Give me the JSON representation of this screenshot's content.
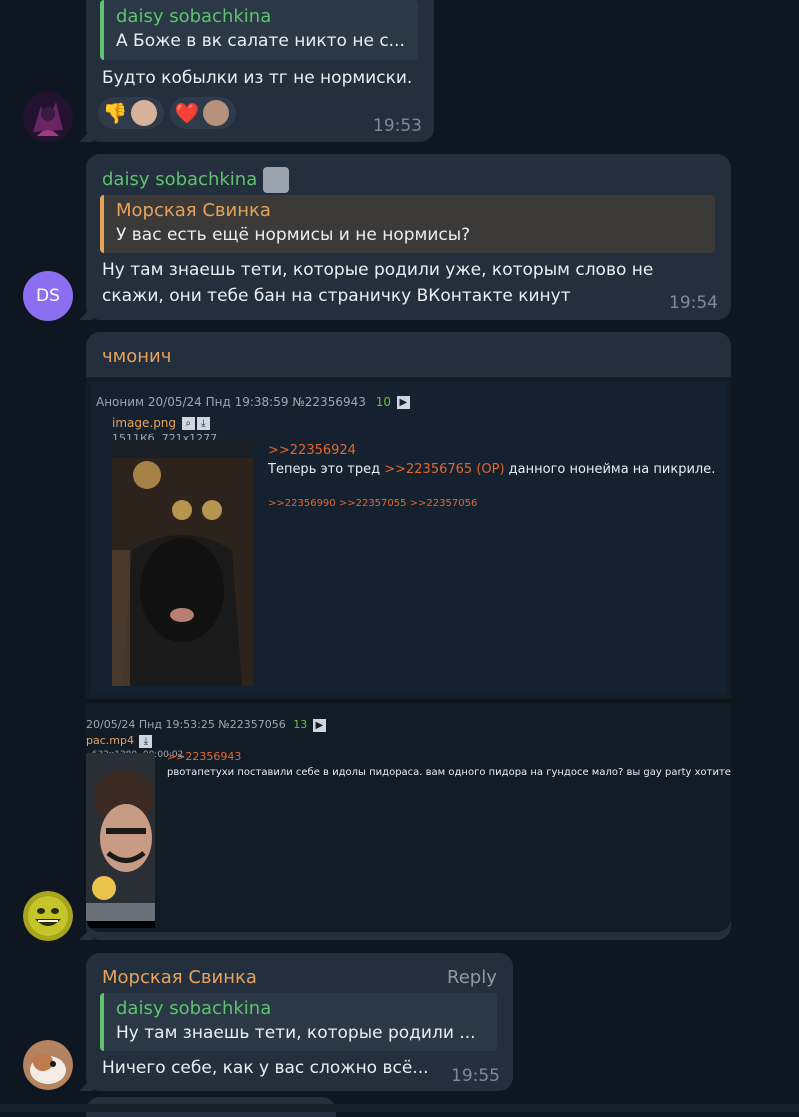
{
  "messages": [
    {
      "quote_name": "daisy sobachkina",
      "quote_text": "А Боже в вк салате никто не с...",
      "text": "Будто кобылки из тг не нормиски.",
      "time": "19:53",
      "reactions": [
        "👎",
        "❤️"
      ]
    },
    {
      "sender": "daisy sobachkina",
      "avatar_initials": "DS",
      "quote_name": "Морская Свинка",
      "quote_text": "У вас есть ещё нормисы и не нормисы?",
      "text_line1": "Ну там знаешь тети, которые родили уже, которым слово не",
      "text_line2": "скажи, они тебе бан на страничку ВКонтакте кинут",
      "time": "19:54"
    },
    {
      "sender": "чмонич",
      "post1": {
        "meta": "Аноним  20/05/24 Пнд 19:38:59  №22356943",
        "replies_count": "10",
        "filename": "image.png",
        "fileinfo": "1511Кб, 721x1277",
        "reply_link": ">>22356924",
        "body_prefix": "Теперь это тред ",
        "body_link": ">>22356765 (OP)",
        "body_suffix": " данного нонейма на пикриле.",
        "backlinks": ">>22356990 >>22357055 >>22357056"
      },
      "post2": {
        "meta": "20/05/24 Пнд 19:53:25 №22357056",
        "replies_count": "13",
        "filename": "рас.mp4",
        "fileinfo": ", 632x1280, 00:00:02",
        "reply_link": ">>22356943",
        "body": "рвотапетухи поставили себе в идолы пидораса. вам одного пидора на гундосе мало? вы gay party хотите устро"
      }
    },
    {
      "sender": "Морская Свинка",
      "reply_label": "Reply",
      "quote_name": "daisy sobachkina",
      "quote_text": "Ну там знаешь тети, которые родили ...",
      "text": "Ничего себе, как у вас сложно всё...",
      "time": "19:55"
    }
  ]
}
